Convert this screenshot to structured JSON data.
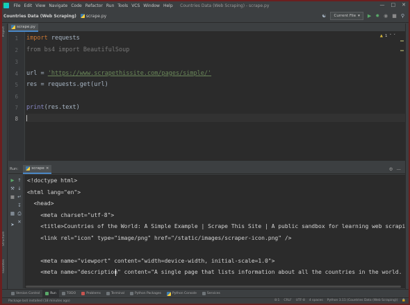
{
  "menubar": {
    "items": [
      "File",
      "Edit",
      "View",
      "Navigate",
      "Code",
      "Refactor",
      "Run",
      "Tools",
      "VCS",
      "Window",
      "Help"
    ],
    "window_title": "Countries Data (Web Scraping) - scrape.py",
    "controls": {
      "minimize": "—",
      "maximize": "□",
      "close": "✕"
    }
  },
  "navbar": {
    "project": "Countries Data (Web Scraping)",
    "file": "scrape.py",
    "run_config": "Current File",
    "run_config_arrow": "▾",
    "user_icon": "user-icon",
    "run_icon": "run-icon",
    "debug_icon": "debug-icon",
    "search_icon": "search-icon"
  },
  "editor": {
    "tab_label": "scrape.py",
    "inspect": {
      "warning_icon": "▲",
      "count": "1",
      "up": "˄",
      "down": "˅"
    },
    "line_numbers": [
      "1",
      "2",
      "3",
      "4",
      "5",
      "6",
      "7",
      "8"
    ],
    "code": {
      "l1_kw": "import",
      "l1_rest": " requests",
      "l2": "from bs4 import BeautifulSoup",
      "l4_pre": "url = ",
      "l4_str": "'https://www.scrapethissite.com/pages/simple/'",
      "l5": "res = requests.get(url)",
      "l7_fn": "print",
      "l7_rest": "(res.text)"
    }
  },
  "run_panel": {
    "title": "Run:",
    "tab_label": "scrape",
    "tab_close": "×",
    "settings_icon": "⚙",
    "hide_icon": "—",
    "output": [
      "<!doctype html>",
      "<html lang=\"en\">",
      "  <head>",
      "    <meta charset=\"utf-8\">",
      "    <title>Countries of the World: A Simple Example | Scrape This Site | A public sandbox for learning web scraping</title>",
      "    <link rel=\"icon\" type=\"image/png\" href=\"/static/images/scraper-icon.png\" />",
      "",
      "    <meta name=\"viewport\" content=\"width=device-width, initial-scale=1.0\">",
      "    <meta name=\"description\" content=\"A single page that lists information about all the countries in the world. Good for those"
    ]
  },
  "left_strip": {
    "project_label": "Project",
    "structure_label": "Structure",
    "favorites_label": "Favorites"
  },
  "toolwindows": [
    "Version Control",
    "Run",
    "TODO",
    "Problems",
    "Terminal",
    "Python Packages",
    "Python Console",
    "Services"
  ],
  "statusbar": {
    "message": "Package bs4 installed (18 minutes ago)",
    "position": "8:1",
    "line_sep": "CRLF",
    "encoding": "UTF-8",
    "indent": "4 spaces",
    "interpreter": "Python 3.11 (Countries Data (Web Scraping))",
    "lock": "🔒"
  },
  "colors": {
    "background": "#2b2b2b",
    "panel": "#3c3f41",
    "keyword": "#cc7832",
    "string": "#6a8759",
    "builtin": "#8888c6",
    "run_green": "#59a869",
    "accent": "#4a88c7"
  }
}
